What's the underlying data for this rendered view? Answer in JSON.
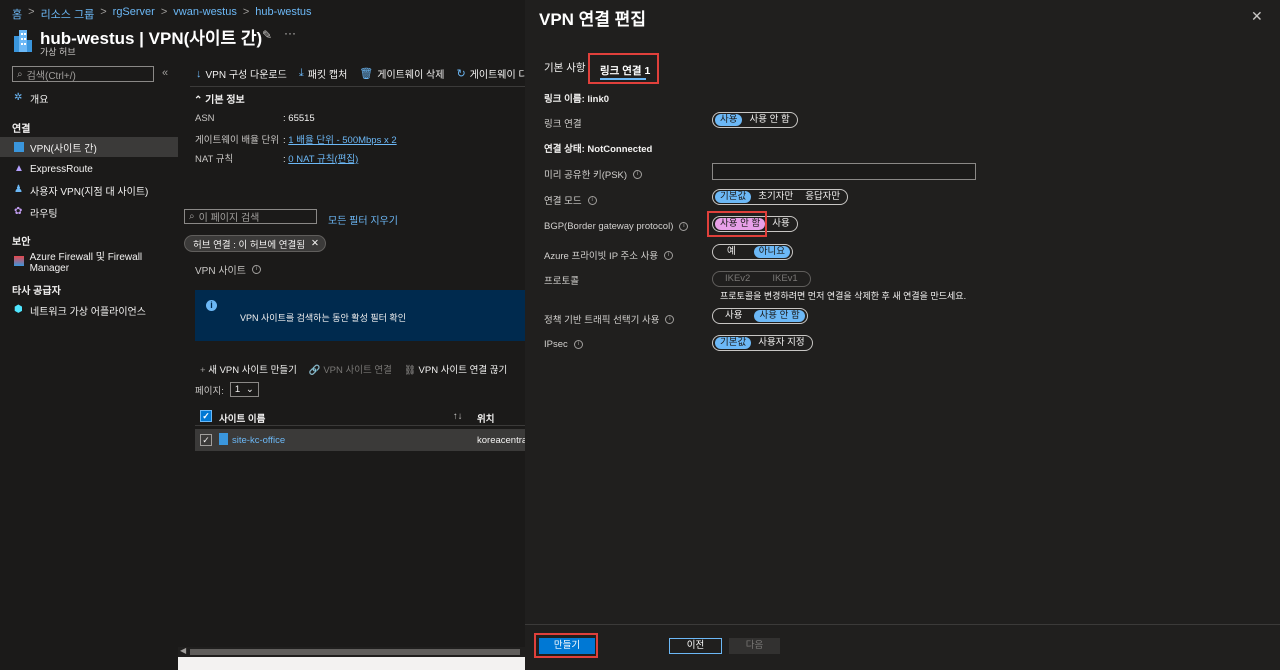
{
  "breadcrumb": [
    "홈",
    "리소스 그룹",
    "rgServer",
    "vwan-westus",
    "hub-westus"
  ],
  "header": {
    "title": "hub-westus | VPN(사이트 간)",
    "subtitle": "가상 허브"
  },
  "sidebar": {
    "search_placeholder": "검색(Ctrl+/)",
    "overview": "개요",
    "section_connection": "연결",
    "items": [
      "VPN(사이트 간)",
      "ExpressRoute",
      "사용자 VPN(지점 대 사이트)",
      "라우팅"
    ],
    "section_security": "보안",
    "security_item": "Azure Firewall 및 Firewall Manager",
    "section_third": "타사 공급자",
    "third_item": "네트워크 가상 어플라이언스"
  },
  "toolbar": [
    "VPN 구성 다운로드",
    "패킷 캡처",
    "게이트웨이 삭제",
    "게이트웨이 다시"
  ],
  "essentials": {
    "heading": "기본 정보",
    "rows": [
      {
        "label": "ASN",
        "value": "65515",
        "link": false
      },
      {
        "label": "게이트웨이 배율 단위",
        "value": "1 배율 단위 - 500Mbps x 2",
        "link": true
      },
      {
        "label": "NAT 규칙",
        "value": "0 NAT 규칙(편집)",
        "link": true
      }
    ]
  },
  "page_search_placeholder": "이 페이지 검색",
  "clear_filters": "모든 필터 지우기",
  "filter_pill": "허브 연결 : 이 허브에 연결됨",
  "vpn_sites_label": "VPN 사이트",
  "info_text": "VPN 사이트를 검색하는 동안 활성 필터 확인",
  "site_toolbar": {
    "create": "새 VPN 사이트 만들기",
    "connect": "VPN 사이트 연결",
    "disconnect": "VPN 사이트 연결 끊기"
  },
  "pages_label": "페이지:",
  "page_value": "1",
  "grid": {
    "col_name": "사이트 이름",
    "col_location": "위치",
    "rows": [
      {
        "name": "site-kc-office",
        "location": "koreacentral"
      }
    ]
  },
  "panel": {
    "title": "VPN 연결 편집",
    "tab_basics": "기본 사항",
    "tab_link": "링크 연결 1",
    "link_name": "링크 이름: link0",
    "link_connection_label": "링크 연결",
    "link_connection_opts": [
      "사용",
      "사용 안 함"
    ],
    "status": "연결 상태: NotConnected",
    "psk_label": "미리 공유한 키(PSK)",
    "psk_value": "",
    "conn_mode_label": "연결 모드",
    "conn_mode_opts": [
      "기본값",
      "초기자만",
      "응답자만"
    ],
    "bgp_label": "BGP(Border gateway protocol)",
    "bgp_opts": [
      "사용 안 함",
      "사용"
    ],
    "private_ip_label": "Azure 프라이빗 IP 주소 사용",
    "private_ip_opts": [
      "예",
      "아니요"
    ],
    "protocol_label": "프로토콜",
    "protocol_opts": [
      "IKEv2",
      "IKEv1"
    ],
    "protocol_help": "프로토콜을 변경하려면 먼저 연결을 삭제한 후 새 연결을 만드세요.",
    "policy_label": "정책 기반 트래픽 선택기 사용",
    "policy_opts": [
      "사용",
      "사용 안 함"
    ],
    "ipsec_label": "IPsec",
    "ipsec_opts": [
      "기본값",
      "사용자 지정"
    ],
    "btn_create": "만들기",
    "btn_prev": "이전",
    "btn_next": "다음"
  },
  "colors": {
    "accent": "#0078d4",
    "link": "#6cb8f6",
    "highlight": "#e0403b"
  }
}
